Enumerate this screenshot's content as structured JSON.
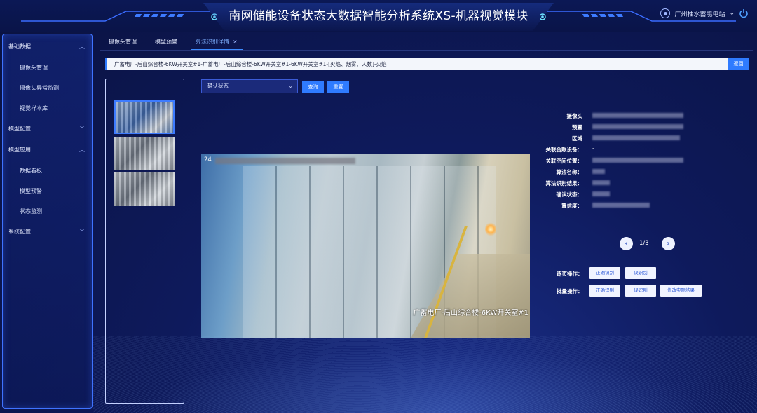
{
  "header": {
    "title": "南网储能设备状态大数据智能分析系统XS-机器视觉模块",
    "station": "广州抽水蓄能电站",
    "station_chevron": "⌄",
    "power_icon": "power-icon"
  },
  "sidebar": {
    "groups": [
      {
        "label": "基础数据",
        "chevron": "︿",
        "items": [
          "摄像头管理",
          "摄像头异常监测",
          "视觉样本库"
        ]
      },
      {
        "label": "模型配置",
        "chevron": "﹀",
        "items": []
      },
      {
        "label": "模型应用",
        "chevron": "︿",
        "items": [
          "数据看板",
          "模型预警",
          "状态监测"
        ]
      },
      {
        "label": "系统配置",
        "chevron": "﹀",
        "items": []
      }
    ]
  },
  "tabs": [
    {
      "label": "摄像头管理"
    },
    {
      "label": "模型预警"
    },
    {
      "label": "算法识别详情",
      "close": "×"
    }
  ],
  "path_bar": "广蓄电厂-后山综合楼-6KW开关室#1-广蓄电厂-后山综合楼-6KW开关室#1-6KW开关室#1-[火焰、烟雾、人数]-火焰",
  "return_label": "返回",
  "filter": {
    "select_value": "确认状态",
    "query_label": "查询",
    "reset_label": "重置"
  },
  "image": {
    "overlay_top": "24",
    "overlay_bottom": "广蓄电厂-后山综合楼-6KW开关室#1"
  },
  "info_labels": {
    "camera": "摄像头",
    "preset": "预置",
    "area": "区域",
    "device": "关联台账设备：",
    "device_value": "-",
    "location": "关联空间位置：",
    "algorithm": "算法名称：",
    "result": "算法识别结果：",
    "confirm": "确认状态：",
    "confidence": "置信度："
  },
  "pager": {
    "text": "1/3",
    "prev": "‹",
    "next": "›"
  },
  "ops": {
    "page_label": "逐页操作：",
    "batch_label": "批量操作：",
    "correct_label": "正确识别",
    "wrong_label": "误识别",
    "modify_label": "修改实际结果"
  }
}
